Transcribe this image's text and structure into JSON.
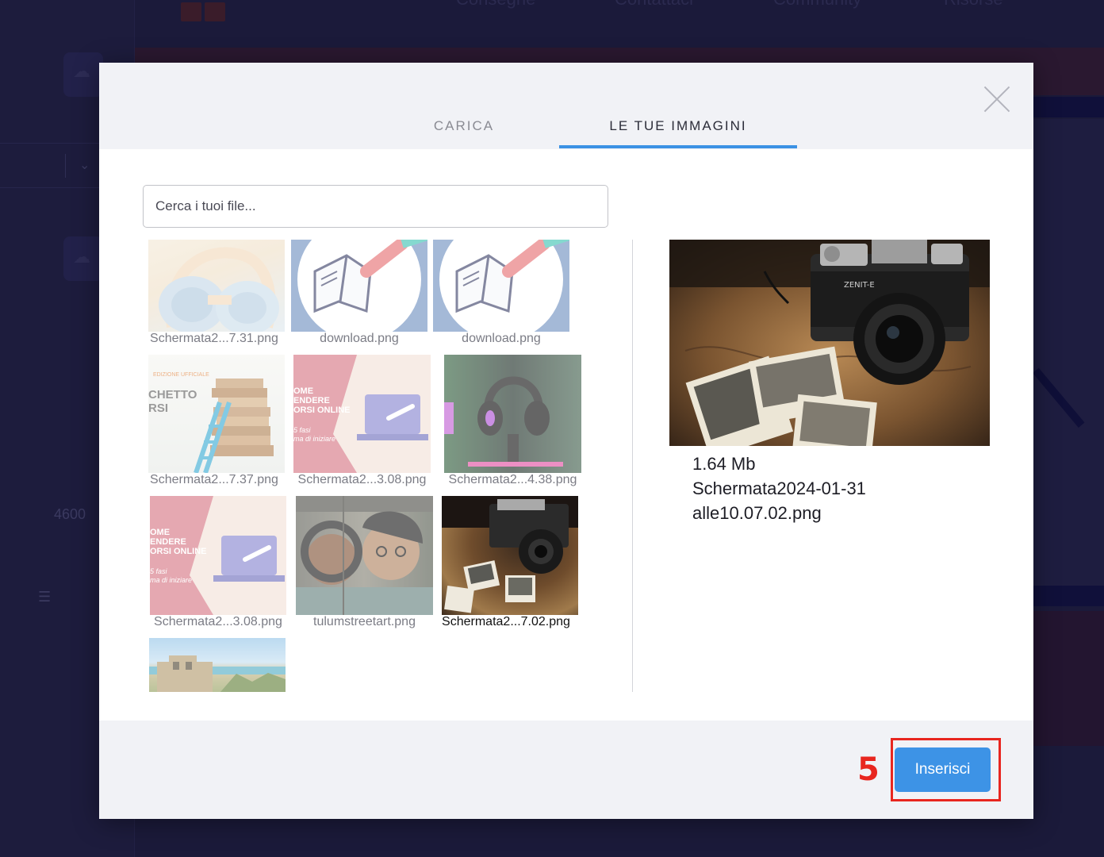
{
  "background": {
    "nav_items": [
      "Consegne",
      "Contattaci",
      "Community",
      "Risorse"
    ],
    "sidebar_value": "4600"
  },
  "modal": {
    "tabs": [
      {
        "label": "CARICA",
        "active": false
      },
      {
        "label": "LE TUE IMMAGINI",
        "active": true
      }
    ],
    "search": {
      "placeholder": "Cerca i tuoi file...",
      "value": ""
    },
    "images": [
      {
        "caption": "Schermata2...7.31.png",
        "picture": "headphones",
        "selected": false
      },
      {
        "caption": "download.png",
        "picture": "book-drawing",
        "selected": false
      },
      {
        "caption": "download.png",
        "picture": "book-drawing",
        "selected": false
      },
      {
        "caption": "Schermata2...7.37.png",
        "picture": "books-stack",
        "selected": false
      },
      {
        "caption": "Schermata2...3.08.png",
        "picture": "sell-courses-banner",
        "selected": false
      },
      {
        "caption": "Schermata2...4.38.png",
        "picture": "gaming-headset",
        "selected": false
      },
      {
        "caption": "Schermata2...3.08.png",
        "picture": "sell-courses-banner",
        "selected": false
      },
      {
        "caption": "tulumstreetart.png",
        "picture": "street-art",
        "selected": false
      },
      {
        "caption": "Schermata2...7.02.png",
        "picture": "vintage-camera",
        "selected": true
      },
      {
        "caption": "",
        "picture": "beach-ruins",
        "selected": false
      }
    ],
    "thumb_texts": {
      "books_top": "EDIZIONE UFFICIALE",
      "books_title": "CHETTO\nRSI",
      "course_title": "OME\nENDERE\nORSI ONLINE",
      "course_sub": "5 fasi\nma di iniziare"
    },
    "preview": {
      "size": "1.64 Mb",
      "filename": "Schermata2024-01-31alle10.07.02.png"
    },
    "footer": {
      "step_number": "5",
      "insert_label": "Inserisci"
    }
  },
  "colors": {
    "accent": "#3d93e6",
    "highlight": "#e8261f"
  },
  "icons": [
    "close-icon",
    "cloud-upload-icon",
    "chevron-down-icon",
    "list-icon"
  ]
}
